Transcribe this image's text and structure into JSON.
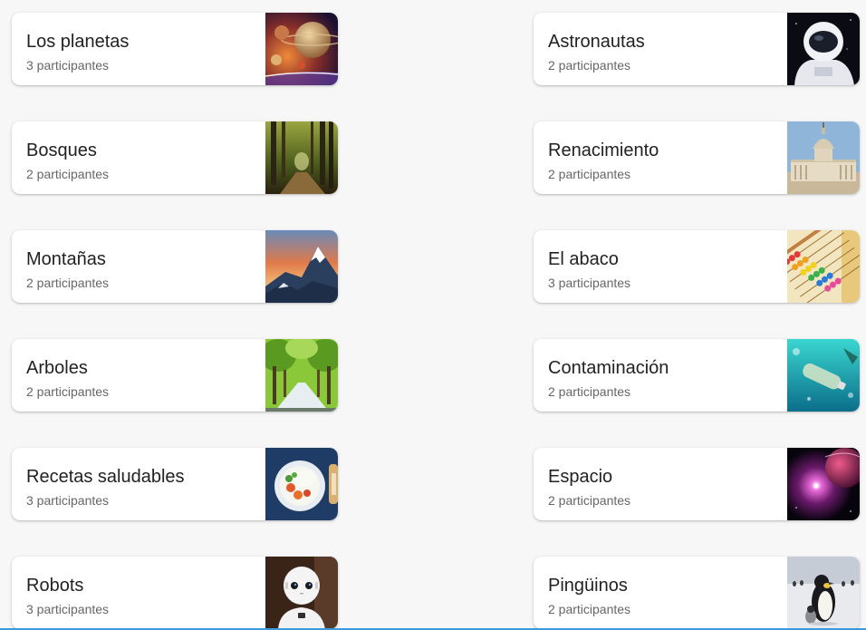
{
  "cards": [
    {
      "title": "Los planetas",
      "participants": "3 participantes",
      "image": "planets-image"
    },
    {
      "title": "Astronautas",
      "participants": "2 participantes",
      "image": "astronaut-image"
    },
    {
      "title": "Bosques",
      "participants": "2 participantes",
      "image": "forest-path-image"
    },
    {
      "title": "Renacimiento",
      "participants": "2 participantes",
      "image": "basilica-image"
    },
    {
      "title": "Montañas",
      "participants": "2 participantes",
      "image": "mountain-image"
    },
    {
      "title": "El abaco",
      "participants": "3 participantes",
      "image": "abacus-image"
    },
    {
      "title": "Arboles",
      "participants": "2 participantes",
      "image": "tree-avenue-image"
    },
    {
      "title": "Contaminación",
      "participants": "2 participantes",
      "image": "ocean-pollution-image"
    },
    {
      "title": "Recetas saludables",
      "participants": "3 participantes",
      "image": "healthy-food-image"
    },
    {
      "title": "Espacio",
      "participants": "2 participantes",
      "image": "space-nebula-image"
    },
    {
      "title": "Robots",
      "participants": "3 participantes",
      "image": "robot-image"
    },
    {
      "title": "Pingüinos",
      "participants": "2 participantes",
      "image": "penguins-image"
    }
  ]
}
